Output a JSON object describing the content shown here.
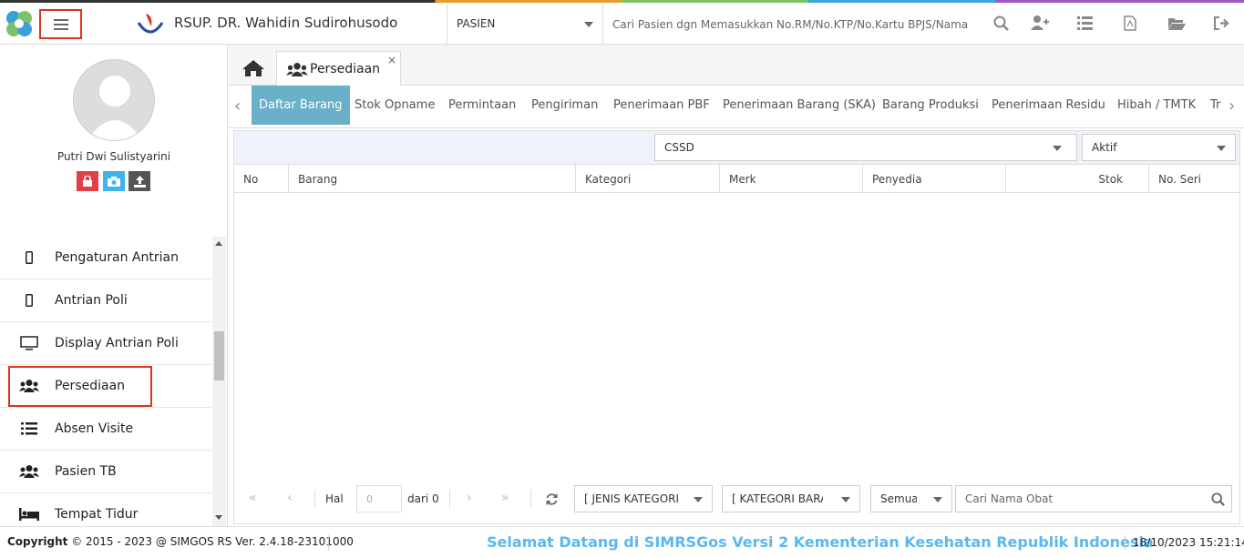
{
  "header": {
    "hospital_name": "RSUP. DR. Wahidin Sudirohusodo",
    "patient_select": "PASIEN",
    "search_placeholder": "Cari Pasien dgn Memasukkan No.RM/No.KTP/No.Kartu BPJS/Nama",
    "icons": [
      "search-icon",
      "add-user-icon",
      "list-icon",
      "pdf-icon",
      "folder-open-icon",
      "logout-icon"
    ]
  },
  "sidebar": {
    "user_name": "Putri Dwi Sulistyarini",
    "buttons": [
      "lock-icon",
      "camera-icon",
      "upload-icon"
    ],
    "items": [
      {
        "label": "Pengaturan Antrian",
        "icon": "mobile-icon"
      },
      {
        "label": "Antrian Poli",
        "icon": "mobile-icon"
      },
      {
        "label": "Display Antrian Poli",
        "icon": "monitor-icon"
      },
      {
        "label": "Persediaan",
        "icon": "users-icon"
      },
      {
        "label": "Absen Visite",
        "icon": "list-icon"
      },
      {
        "label": "Pasien TB",
        "icon": "users-icon"
      },
      {
        "label": "Tempat Tidur",
        "icon": "bed-icon"
      }
    ]
  },
  "tabs": {
    "open_tab": "Persediaan",
    "close": "×"
  },
  "subtabs": [
    "Daftar Barang",
    "Stok Opname",
    "Permintaan",
    "Pengiriman",
    "Penerimaan PBF",
    "Penerimaan Barang (SKA)",
    "Barang Produksi",
    "Penerimaan Residu",
    "Hibah / TMTK",
    "Tr"
  ],
  "filters": {
    "unit": "CSSD",
    "status": "Aktif"
  },
  "grid": {
    "columns": [
      "No",
      "Barang",
      "Kategori",
      "Merk",
      "Penyedia",
      "Stok",
      "No. Seri"
    ]
  },
  "pager": {
    "hal_label": "Hal",
    "page_value": "0",
    "of_label": "dari 0",
    "jenis_kategori": "[ JENIS KATEGORI",
    "kategori_barang": "[ KATEGORI BARA",
    "semua": "Semua",
    "search_placeholder": "Cari Nama Obat"
  },
  "footer": {
    "copyright_prefix": "Copyright",
    "copyright": "2015 - 2023 @ SIMGOS RS Ver. 2.4.18-23101000",
    "welcome": "Selamat Datang di SIMRSGos Versi 2 Kementerian Kesehatan Republik Indonesia",
    "datetime": "18/10/2023 15:21:14"
  },
  "colors": {
    "accent": "#6ab0c8",
    "highlight": "#dd3322",
    "welcome": "#5ab8f0"
  }
}
